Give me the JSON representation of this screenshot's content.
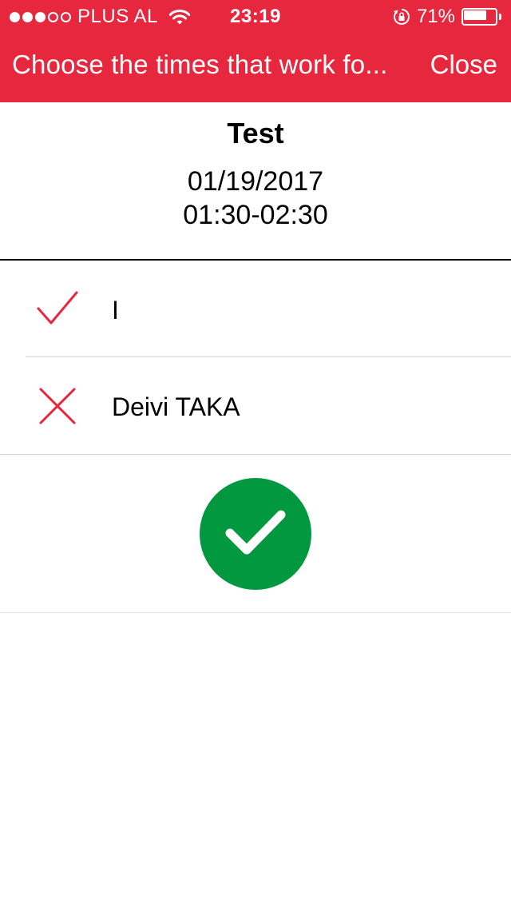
{
  "status_bar": {
    "carrier": "PLUS AL",
    "time": "23:19",
    "battery_text": "71%",
    "battery_level": 0.71,
    "signal_bars_filled": 3,
    "signal_bars_total": 5
  },
  "nav": {
    "title": "Choose the times that work fo...",
    "close_label": "Close"
  },
  "event": {
    "name": "Test",
    "date": "01/19/2017",
    "time_range": "01:30-02:30"
  },
  "participants": [
    {
      "name": "I",
      "status": "accepted",
      "icon": "checkmark-icon"
    },
    {
      "name": "Deivi TAKA",
      "status": "declined",
      "icon": "cross-icon"
    }
  ],
  "colors": {
    "header_bg": "#E6273E",
    "accent_red": "#E6273E",
    "confirm_green": "#019840"
  },
  "confirm": {
    "icon": "checkmark-icon"
  }
}
